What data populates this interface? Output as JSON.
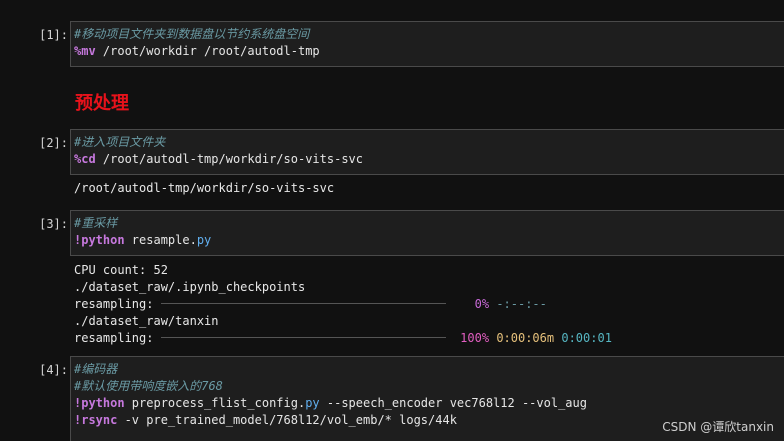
{
  "cells": [
    {
      "prompt": "[1]:",
      "comment": "#移动项目文件夹到数据盘以节约系统盘空间",
      "magic": "%mv",
      "args": " /root/workdir /root/autodl-tmp"
    },
    {
      "heading": "预处理"
    },
    {
      "prompt": "[2]:",
      "comment": "#进入项目文件夹",
      "magic": "%cd",
      "args": " /root/autodl-tmp/workdir/so-vits-svc",
      "output": "/root/autodl-tmp/workdir/so-vits-svc"
    },
    {
      "prompt": "[3]:",
      "comment": "#重采样",
      "magic": "!python",
      "args_plain": " resample.",
      "args_ext": "py",
      "output_lines": [
        "CPU count: 52",
        "./dataset_raw/.ipynb_checkpoints",
        "./dataset_raw/tanxin"
      ],
      "progress1": {
        "label": "resampling:",
        "pct": "0%",
        "time": "-:--:--",
        "value": 0
      },
      "progress2": {
        "label": "resampling:",
        "pct": "100%",
        "time1": "0:00:06m",
        "time2": "0:00:01",
        "value": 100
      }
    },
    {
      "prompt": "[4]:",
      "comment1": "#编码器",
      "comment2": "#默认使用带响度嵌入的768",
      "line3_magic": "!python",
      "line3_args": " preprocess_flist_config.",
      "line3_ext": "py",
      "line3_rest": " --speech_encoder vec768l12 --vol_aug",
      "line4_magic": "!rsync",
      "line4_args": " -v pre_trained_model/768l12/vol_emb/* logs/44k"
    }
  ],
  "watermark": "CSDN @谭欣tanxin"
}
